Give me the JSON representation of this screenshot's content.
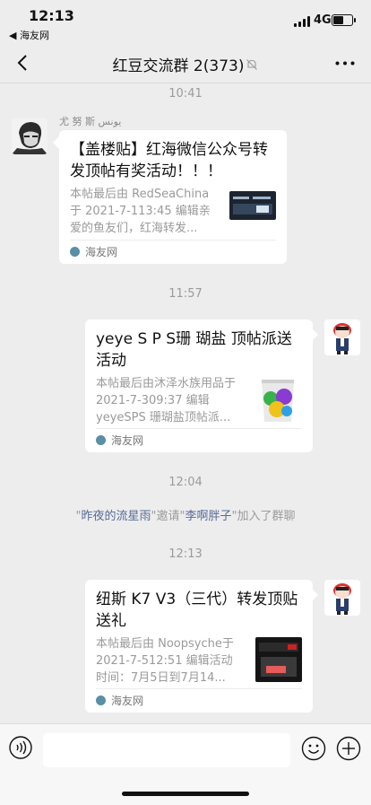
{
  "status": {
    "time": "12:13",
    "back_app": "◀ 海友网",
    "network": "4G"
  },
  "nav": {
    "title": "红豆交流群 2(373)"
  },
  "messages": {
    "t1": "10:41",
    "m1": {
      "sender": "尤 努 斯  يونس",
      "title": "【盖楼贴】红海微信公众号转发顶帖有奖活动！！！",
      "desc": "本帖最后由 RedSeaChina 于 2021-7-113:45 编辑亲爱的鱼友们，红海转发...",
      "source": "海友网"
    },
    "t2": "11:57",
    "m2": {
      "title": "yeye S P S珊 瑚盐 顶帖派送活动",
      "desc": "本帖最后由沐泽水族用品于 2021-7-309:37 编辑 yeyeSPS 珊瑚盐顶帖派...",
      "source": "海友网"
    },
    "t3": "12:04",
    "sys": {
      "q1": "\"",
      "name1": "昨夜的流星雨",
      "mid": "\"邀请\"",
      "name2": "李啊胖子",
      "tail": "\"加入了群聊"
    },
    "t4": "12:13",
    "m3": {
      "title": "纽斯 K7 V3（三代）转发顶贴送礼",
      "desc": "本帖最后由 Noopsyche于 2021-7-512:51 编辑活动时间：7月5日到7月14...",
      "source": "海友网"
    }
  },
  "input": {
    "value": "",
    "placeholder": ""
  },
  "colors": {
    "background": "#ededed",
    "link": "#576b95",
    "card": "#ffffff"
  }
}
